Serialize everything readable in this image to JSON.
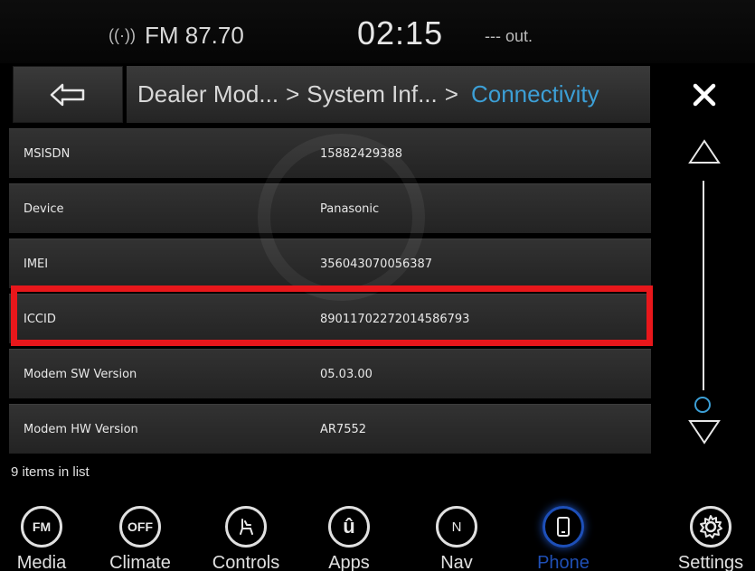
{
  "status": {
    "radio_icon": "antenna-icon",
    "radio": "FM 87.70",
    "time": "02:15",
    "temperature": "--- out."
  },
  "nav": {
    "breadcrumb": [
      "Dealer Mod...",
      "System Inf...",
      "Connectivity"
    ],
    "separator": ">",
    "back_icon": "back-arrow-icon",
    "close_icon": "close-icon"
  },
  "list": {
    "rows": [
      {
        "key": "MSISDN",
        "value": "15882429388"
      },
      {
        "key": "Device",
        "value": "Panasonic"
      },
      {
        "key": "IMEI",
        "value": "356043070056387"
      },
      {
        "key": "ICCID",
        "value": "89011702272014586793"
      },
      {
        "key": "Modem SW Version",
        "value": "05.03.00"
      },
      {
        "key": "Modem HW Version",
        "value": "AR7552"
      }
    ],
    "count_label": "9 items in list",
    "highlight_color": "#e8171b",
    "scroll_position": 1.0
  },
  "dock": {
    "items": [
      {
        "label": "Media",
        "icon_text": "FM",
        "icon": "fm-icon"
      },
      {
        "label": "Climate",
        "icon_text": "OFF",
        "icon": "climate-icon"
      },
      {
        "label": "Controls",
        "icon_text": "",
        "icon": "seat-controls-icon"
      },
      {
        "label": "Apps",
        "icon_text": "û",
        "icon": "apps-icon"
      },
      {
        "label": "Nav",
        "icon_text": "N",
        "icon": "compass-icon"
      },
      {
        "label": "Phone",
        "icon_text": "",
        "icon": "phone-icon"
      },
      {
        "label": "Settings",
        "icon_text": "",
        "icon": "gear-icon"
      }
    ],
    "active": "Phone",
    "accent_color": "#1f4fb5"
  }
}
